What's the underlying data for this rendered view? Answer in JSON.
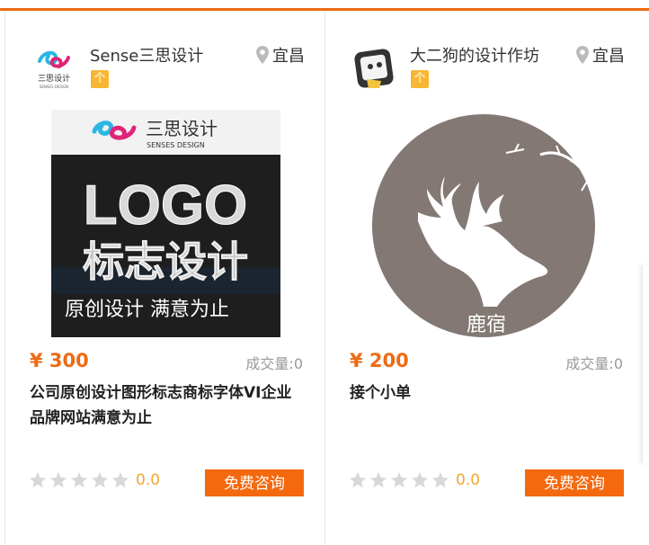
{
  "colors": {
    "accent": "#ee6a14",
    "badge": "#f7b733",
    "button": "#f4690d"
  },
  "cards": [
    {
      "shop_name": "Sense三思设计",
      "badge": "个",
      "location": "宜昌",
      "logo_text": "三思设计",
      "thumb": {
        "brand_cn": "三思设计",
        "brand_en": "SENSES DESIGN",
        "line1": "LOGO",
        "line2": "标志设计",
        "line3": "原创设计 满意为止"
      },
      "price": "¥ 300",
      "sales_label": "成交量:",
      "sales_count": "0",
      "title": "公司原创设计图形标志商标字体VI企业品牌网站满意为止",
      "rating": {
        "stars": 0,
        "score": "0.0"
      },
      "button": "免费咨询"
    },
    {
      "shop_name": "大二狗的设计作坊",
      "badge": "个",
      "location": "宜昌",
      "thumb": {
        "label": "鹿宿"
      },
      "price": "¥ 200",
      "sales_label": "成交量:",
      "sales_count": "0",
      "title": "接个小单",
      "rating": {
        "stars": 0,
        "score": "0.0"
      },
      "button": "免费咨询"
    }
  ]
}
